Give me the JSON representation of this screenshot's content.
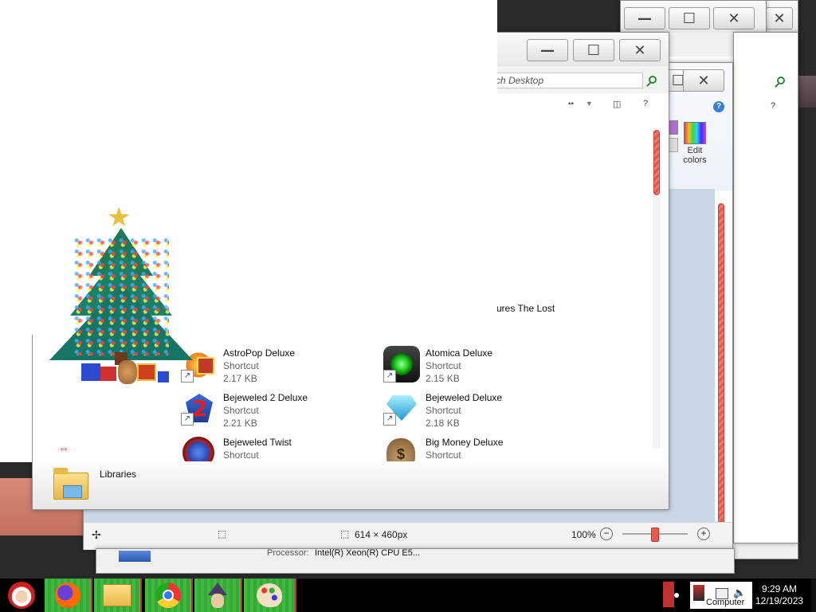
{
  "colors": {
    "taskbar": "#000000",
    "taskbar_button": "#3fba3f",
    "accent_red": "#c03030",
    "search_icon": "#2a8a3a"
  },
  "back_window": {
    "help": "?"
  },
  "search": {
    "placeholder": "ch Desktop"
  },
  "paint": {
    "edit_colors_line1": "Edit",
    "edit_colors_line2": "colors",
    "help": "?"
  },
  "desktop_text": {
    "fragment": "ures The Lost"
  },
  "files": [
    {
      "name": "AstroPop Deluxe",
      "type": "Shortcut",
      "size": "2.17 KB",
      "icon": "astropop-icon"
    },
    {
      "name": "Atomica Deluxe",
      "type": "Shortcut",
      "size": "2.15 KB",
      "icon": "atomica-icon"
    },
    {
      "name": "Bejeweled 2 Deluxe",
      "type": "Shortcut",
      "size": "2.21 KB",
      "icon": "bejeweled2-icon"
    },
    {
      "name": "Bejeweled Deluxe",
      "type": "Shortcut",
      "size": "2.18 KB",
      "icon": "bejeweled-icon"
    },
    {
      "name": "Bejeweled Twist",
      "type": "Shortcut",
      "icon": "bejeweled-twist-icon"
    },
    {
      "name": "Big Money Deluxe",
      "type": "Shortcut",
      "icon": "big-money-icon"
    }
  ],
  "nav": {
    "libraries": "Libraries"
  },
  "toolbar": {
    "help": "?"
  },
  "statusbar": {
    "dimensions": "614 × 460px",
    "zoom": "100%",
    "zoom_minus": "−",
    "zoom_plus": "+"
  },
  "system": {
    "processor_label": "Processor:",
    "processor_value": "Intel(R) Xeon(R) CPU E5..."
  },
  "tray": {
    "computer_label": "Computer",
    "time": "9:29 AM",
    "date": "12/19/2023"
  },
  "taskbar": {
    "apps": [
      "santa-icon",
      "firefox-icon",
      "explorer-icon",
      "chrome-icon",
      "wizard-icon",
      "paint-icon"
    ]
  }
}
